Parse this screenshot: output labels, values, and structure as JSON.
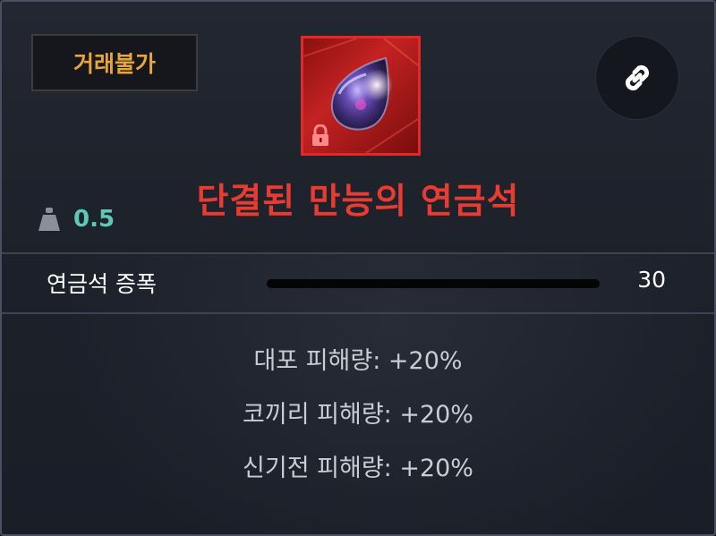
{
  "tooltip": {
    "trade_badge": "거래불가",
    "item_name": "단결된 만능의 연금석",
    "weight": "0.5",
    "stat": {
      "label": "연금석 증폭",
      "value": "30",
      "bar_fill_fraction": 1.0
    },
    "effects": [
      "대포 피해량: +20%",
      "코끼리 피해량: +20%",
      "신기전 피해량: +20%"
    ],
    "icons": {
      "link": "link-icon",
      "weight": "weight-icon",
      "lock": "lock-icon",
      "item": "alchemy-stone-icon"
    },
    "colors": {
      "trade_badge_text": "#e8a53a",
      "item_name": "#e83b32",
      "weight_value": "#5cc8b8",
      "item_frame_border": "#e02a2a"
    }
  }
}
